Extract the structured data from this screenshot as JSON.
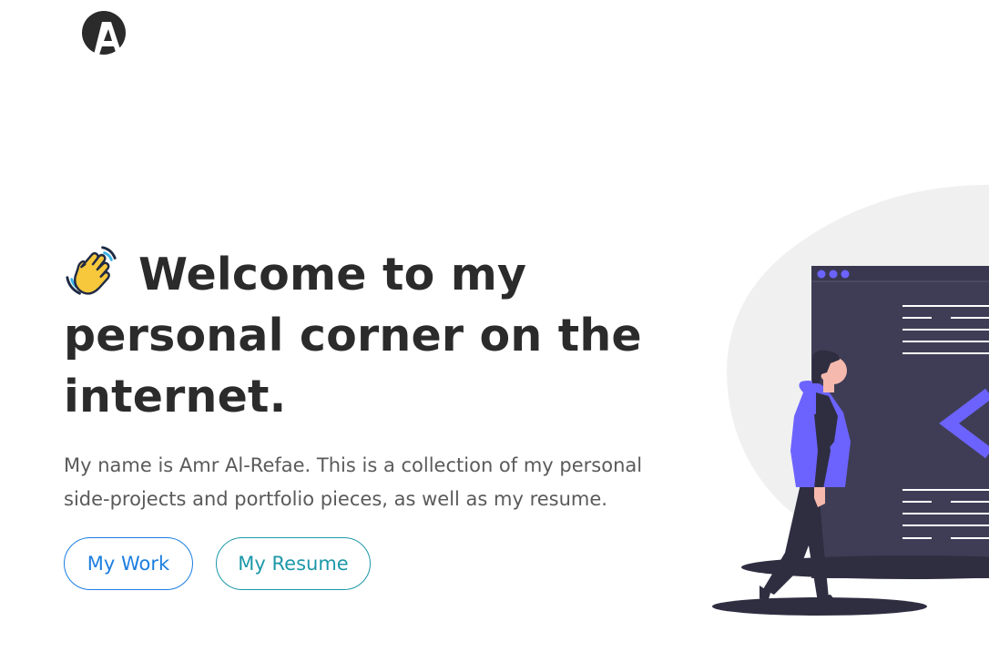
{
  "header": {
    "logo_icon": "monogram-a-logo"
  },
  "hero": {
    "wave_icon": "waving-hand-emoji",
    "headline": "Welcome to my personal corner on the internet.",
    "intro": "My name is Amr Al-Refae. This is a collection of my personal side-projects and portfolio pieces, as well as my resume."
  },
  "buttons": {
    "work_label": "My Work",
    "resume_label": "My Resume"
  },
  "colors": {
    "text": "#2b2b2b",
    "muted_text": "#5a5a5a",
    "work_button": "#1c7ee0",
    "resume_button": "#1d98a8",
    "accent_purple": "#6c63ff",
    "screen_dark": "#3f3d56",
    "blob_gray": "#f0f0f0"
  },
  "illustration": {
    "icon": "developer-at-screen-illustration"
  }
}
